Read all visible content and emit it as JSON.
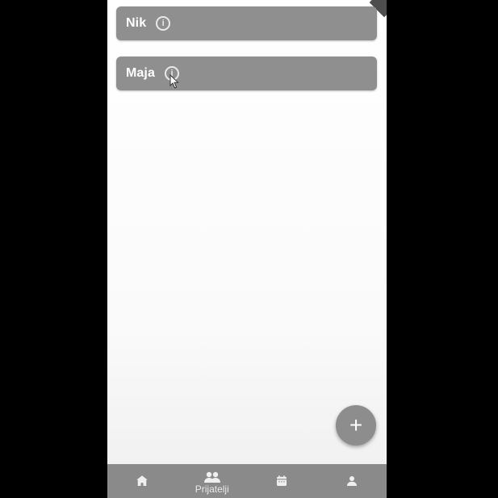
{
  "friends": [
    {
      "name": "Nik",
      "info_icon": "info-icon"
    },
    {
      "name": "Maja",
      "info_icon": "info-icon"
    }
  ],
  "fab": {
    "icon": "plus-icon",
    "label": "+"
  },
  "bottom_nav": {
    "items": [
      {
        "icon": "home-icon",
        "label": ""
      },
      {
        "icon": "people-icon",
        "label": "Prijatelji"
      },
      {
        "icon": "calendar-icon",
        "label": ""
      },
      {
        "icon": "person-icon",
        "label": ""
      }
    ],
    "active_index": 1
  },
  "colors": {
    "card": "#8f8f8f",
    "nav": "#8a8a8a",
    "fab": "#8d8d8d",
    "text": "#ffffff"
  }
}
